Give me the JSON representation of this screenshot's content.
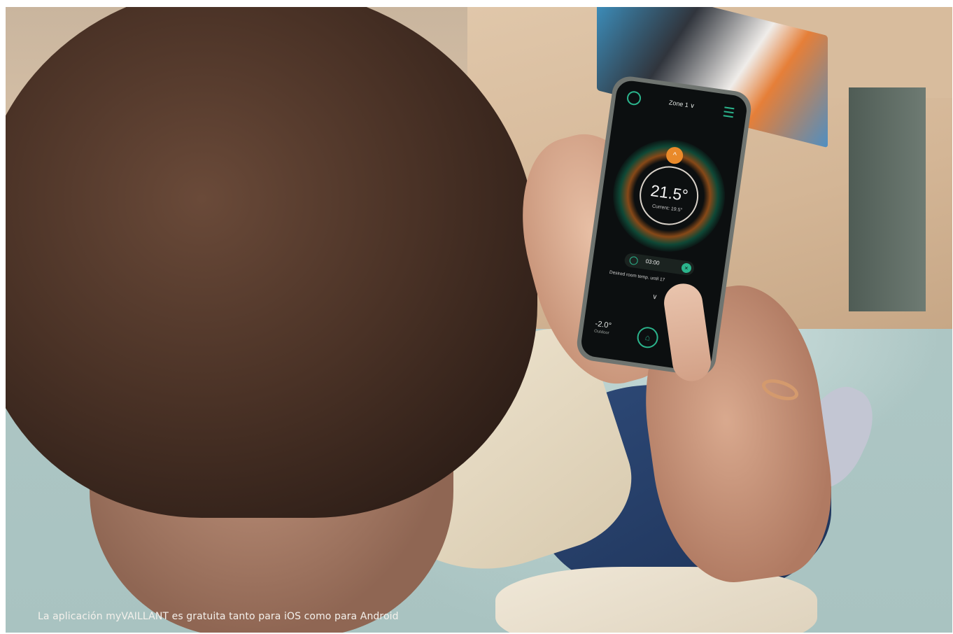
{
  "caption": "La aplicación myVAILLANT es gratuita tanto para iOS como para Android",
  "app": {
    "zone_label": "Zone 1 ∨",
    "temperature": "21.5°",
    "current": "Current: 19.5°",
    "timer": "03:00",
    "desired": "Desired room temp. until 17",
    "outdoor_temp": "-2.0°",
    "outdoor_label": "Outdoor",
    "up_symbol": "^",
    "down_symbol": "∨",
    "cancel_symbol": "×",
    "home_symbol": "⌂"
  },
  "colors": {
    "accent_green": "#2bb48c",
    "accent_orange": "#e98a2a"
  },
  "icons": [
    "app-logo-icon",
    "menu-icon",
    "up-chevron-icon",
    "timer-icon",
    "close-icon",
    "down-chevron-icon",
    "home-icon"
  ]
}
